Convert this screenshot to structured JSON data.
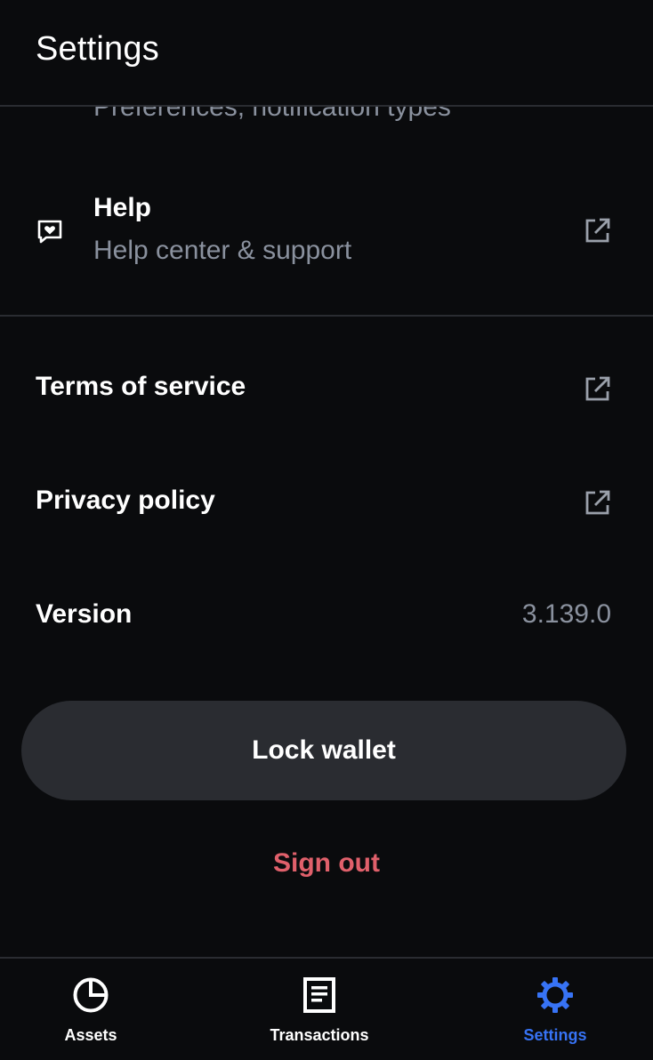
{
  "header": {
    "title": "Settings"
  },
  "notifications_item": {
    "subtitle": "Preferences, notification types"
  },
  "help_item": {
    "icon": "chat-heart-icon",
    "title": "Help",
    "subtitle": "Help center & support",
    "action_icon": "external-link-icon"
  },
  "terms_item": {
    "label": "Terms of service",
    "action_icon": "external-link-icon"
  },
  "privacy_item": {
    "label": "Privacy policy",
    "action_icon": "external-link-icon"
  },
  "version_item": {
    "label": "Version",
    "value": "3.139.0"
  },
  "lock_button": {
    "label": "Lock wallet"
  },
  "sign_out": {
    "label": "Sign out"
  },
  "bottom_nav": {
    "items": [
      {
        "label": "Assets",
        "icon": "pie-chart-icon",
        "active": false
      },
      {
        "label": "Transactions",
        "icon": "document-icon",
        "active": false
      },
      {
        "label": "Settings",
        "icon": "gear-icon",
        "active": true
      }
    ]
  },
  "colors": {
    "background": "#0a0b0d",
    "text_primary": "#ffffff",
    "text_secondary": "#8a919e",
    "divider": "#2a2c31",
    "button_bg": "#2a2c31",
    "danger": "#e0606b",
    "accent": "#3773f5"
  }
}
